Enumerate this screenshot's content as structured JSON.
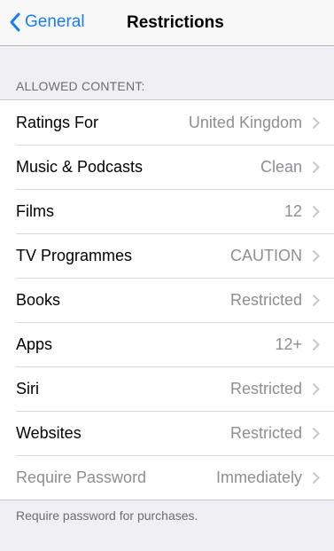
{
  "navbar": {
    "back_label": "General",
    "title": "Restrictions",
    "back_icon": "chevron-left-icon",
    "accent_color": "#1a7cf5"
  },
  "section": {
    "header": "ALLOWED CONTENT:"
  },
  "rows": [
    {
      "label": "Ratings For",
      "value": "United Kingdom",
      "disabled": false
    },
    {
      "label": "Music & Podcasts",
      "value": "Clean",
      "disabled": false
    },
    {
      "label": "Films",
      "value": "12",
      "disabled": false
    },
    {
      "label": "TV Programmes",
      "value": "CAUTION",
      "disabled": false
    },
    {
      "label": "Books",
      "value": "Restricted",
      "disabled": false
    },
    {
      "label": "Apps",
      "value": "12+",
      "disabled": false
    },
    {
      "label": "Siri",
      "value": "Restricted",
      "disabled": false
    },
    {
      "label": "Websites",
      "value": "Restricted",
      "disabled": false
    },
    {
      "label": "Require Password",
      "value": "Immediately",
      "disabled": true
    }
  ],
  "footer": {
    "note": "Require password for purchases."
  }
}
